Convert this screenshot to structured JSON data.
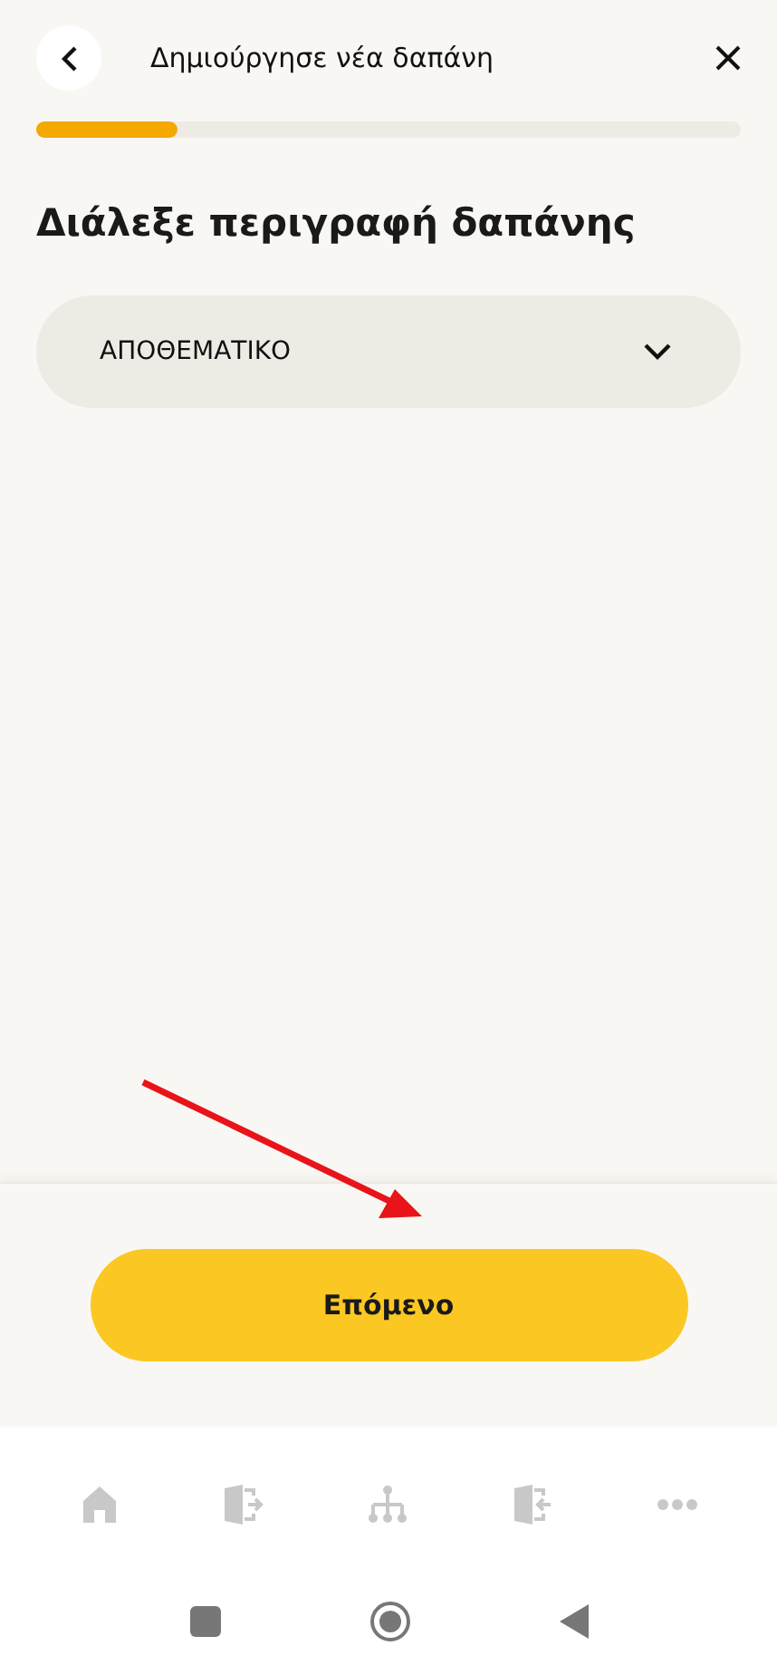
{
  "header": {
    "title": "Δημιούργησε νέα δαπάνη"
  },
  "progress": {
    "level": 0.2
  },
  "heading": "Διάλεξε περιγραφή δαπάνης",
  "dropdown": {
    "value": "ΑΠΟΘΕΜΑΤΙΚΟ"
  },
  "next_button": "Επόμενο",
  "bottom_nav": [
    {
      "kind": "home"
    },
    {
      "kind": "exit"
    },
    {
      "kind": "tree"
    },
    {
      "kind": "enter"
    },
    {
      "kind": "more"
    }
  ],
  "system_bar": [
    {
      "kind": "recents"
    },
    {
      "kind": "home"
    },
    {
      "kind": "back"
    }
  ]
}
